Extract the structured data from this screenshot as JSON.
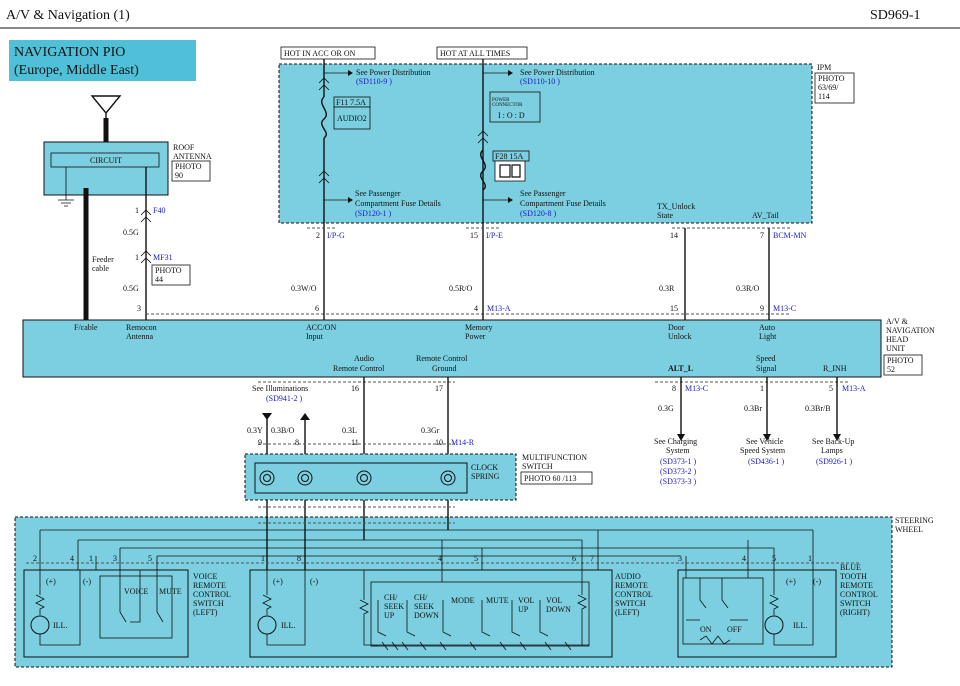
{
  "header": {
    "title": "A/V & Navigation (1)",
    "code": "SD969-1"
  },
  "title_box": {
    "line1": "NAVIGATION PIO",
    "line2": "(Europe, Middle East)"
  },
  "power_labels": {
    "acc": "HOT IN ACC OR ON",
    "all": "HOT AT ALL TIMES"
  },
  "ipm": {
    "name": "IPM",
    "photo": [
      "PHOTO",
      "63/69/",
      "114"
    ],
    "see_power_1": "See Power Distribution",
    "see_power_1_ref": "(SD110-9 )",
    "see_power_2": "See Power Distribution",
    "see_power_2_ref": "(SD110-10 )",
    "fuse1": "F11 7.5A",
    "fuse1_name": "AUDIO2",
    "power_connector_1": "POWER",
    "power_connector_2": "CONNECTOR",
    "iod": "I : O : D",
    "fuse2": "F28 15A",
    "see_pass_1a": "See Passenger",
    "see_pass_1b": "Compartment Fuse Details",
    "see_pass_1_ref": "(SD120-1 )",
    "see_pass_2a": "See Passenger",
    "see_pass_2b": "Compartment Fuse Details",
    "see_pass_2_ref": "(SD120-8 )",
    "tx_unlock_1": "TX_Unlock",
    "tx_unlock_2": "State",
    "av_tail": "AV_Tail"
  },
  "antenna": {
    "circuit": "CIRCUIT",
    "label": [
      "ROOF",
      "ANTENNA"
    ],
    "photo": [
      "PHOTO",
      "90"
    ],
    "feeder": [
      "Feeder",
      "cable"
    ],
    "pin1": "1",
    "f40": "F40",
    "wire1": "0.5G",
    "pin_mf": "1",
    "mf31": "MF31",
    "mf_photo": [
      "PHOTO",
      "44"
    ],
    "wire2": "0.5G",
    "pin3": "3"
  },
  "top_connectors": {
    "c1_pin": "2",
    "c1_name": "I/P-G",
    "c1_wire": "0.3W/O",
    "c1_pin2": "6",
    "c2_pin": "15",
    "c2_name": "I/P-E",
    "c2_wire": "0.5R/O",
    "c2_pin2": "4",
    "c2_name2": "M13-A",
    "c3_pin": "14",
    "c3_wire": "0.3R",
    "c3_pin2": "15",
    "c4_pin": "7",
    "c4_name": "BCM-MN",
    "c4_wire": "0.3R/O",
    "c4_pin2": "9",
    "c4_name2": "M13-C"
  },
  "head_unit": {
    "label": [
      "A/V &",
      "NAVIGATION",
      "HEAD",
      "UNIT"
    ],
    "photo": [
      "PHOTO",
      "52"
    ],
    "f_cable": "F/cable",
    "remocon": [
      "Remocon",
      "Antenna"
    ],
    "acc_on": [
      "ACC/ON",
      "Input"
    ],
    "memory": [
      "Memory",
      "Power"
    ],
    "door": [
      "Door",
      "Unlock"
    ],
    "auto_light": [
      "Auto",
      "Light"
    ],
    "audio_remote": [
      "Audio",
      "Remote Control"
    ],
    "remote_ground": [
      "Remote Control",
      "Ground"
    ],
    "alt_l": "ALT_L",
    "speed": [
      "Speed",
      "Signal"
    ],
    "r_inh": "R_INH"
  },
  "bottom_connectors": {
    "illum": "See Illuminations",
    "illum_ref": "(SD941-2 )",
    "p16": "16",
    "p17": "17",
    "w1": "0.3Y",
    "w2": "0.3B/O",
    "w3": "0.3L",
    "w4": "0.3Gr",
    "p9": "9",
    "p8": "8",
    "p11": "11",
    "p10": "10",
    "m14": "M14-R",
    "alt_pin": "8",
    "alt_conn": "M13-C",
    "alt_wire": "0.3G",
    "charge": [
      "See Charging",
      "System"
    ],
    "charge_refs": [
      "(SD373-1 )",
      "(SD373-2 )",
      "(SD373-3 )"
    ],
    "speed_pin": "1",
    "speed_wire": "0.3Br",
    "speed_see": [
      "See Vehicle",
      "Speed System"
    ],
    "speed_ref": "(SD436-1 )",
    "rinh_pin": "5",
    "rinh_conn": "M13-A",
    "rinh_wire": "0.3Br/B",
    "backup": [
      "See Back-Up",
      "Lamps"
    ],
    "backup_ref": "(SD926-1 )"
  },
  "clock_spring": {
    "name": [
      "CLOCK",
      "SPRING"
    ],
    "switch": [
      "MULTIFUNCTION",
      "SWITCH"
    ],
    "photo": "PHOTO 60 /113"
  },
  "steering": {
    "label": [
      "STEERING",
      "WHEEL"
    ],
    "voice": {
      "pins": [
        "2",
        "4",
        "1",
        "3",
        "5"
      ],
      "plus": "(+)",
      "minus": "(-)",
      "ill": "ILL.",
      "voice": "VOICE",
      "mute": "MUTE",
      "name": [
        "VOICE",
        "REMOTE",
        "CONTROL",
        "SWITCH",
        "(LEFT)"
      ]
    },
    "audio": {
      "pins": [
        "1",
        "8",
        "4",
        "5",
        "6",
        "7"
      ],
      "plus": "(+)",
      "minus": "(-)",
      "ill": "ILL.",
      "ch_up": [
        "CH/",
        "SEEK",
        "UP"
      ],
      "ch_down": [
        "CH/",
        "SEEK",
        "DOWN"
      ],
      "mode": "MODE",
      "mute": "MUTE",
      "vol_up": [
        "VOL",
        "UP"
      ],
      "vol_down": [
        "VOL",
        "DOWN"
      ],
      "name": [
        "AUDIO",
        "REMOTE",
        "CONTROL",
        "SWITCH",
        "(LEFT)"
      ]
    },
    "bt": {
      "pins": [
        "3",
        "4",
        "5",
        "1"
      ],
      "plus": "(+)",
      "minus": "(-)",
      "ill": "ILL.",
      "on": "ON",
      "off": "OFF",
      "name": [
        "BLUE",
        "TOOTH",
        "REMOTE",
        "CONTROL",
        "SWITCH",
        "(RIGHT)"
      ]
    }
  }
}
